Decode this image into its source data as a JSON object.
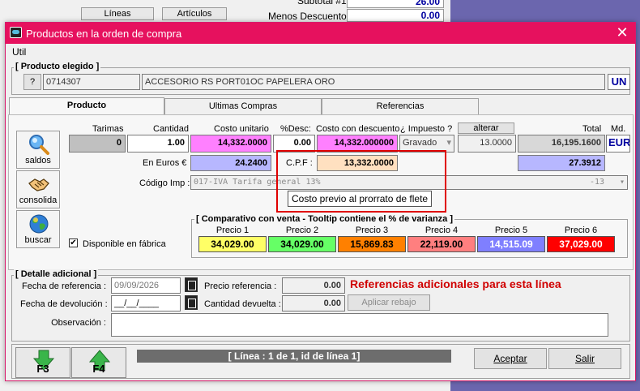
{
  "background": {
    "btn_lineas": "Líneas",
    "btn_articulos": "Artículos",
    "subtotal_label": "Subtotal #1 :",
    "subtotal_value": "26.00",
    "menos_descuento_label": "Menos Descuento :",
    "menos_descuento_value": "0.00"
  },
  "window": {
    "title": "Productos en la orden de compra",
    "menu_util": "Util"
  },
  "producto_elegido": {
    "group_label": "[ Producto elegido ]",
    "help_btn": "?",
    "code": "0714307",
    "description": "ACCESORIO RS PORT01OC PAPELERA ORO",
    "unit": "UN"
  },
  "tabs": [
    "Producto",
    "Ultimas Compras",
    "Referencias"
  ],
  "side_buttons": {
    "saldos": "saldos",
    "consolida": "consolida",
    "buscar": "buscar"
  },
  "grid": {
    "headers": {
      "tarimas": "Tarimas",
      "cantidad": "Cantidad",
      "costo_unitario": "Costo unitario",
      "desc": "%Desc:",
      "costo_con_desc": "Costo con descuento",
      "impuesto": "¿ Impuesto ?",
      "alterar": "alterar",
      "total": "Total",
      "md": "Md."
    },
    "tarimas": "0",
    "cantidad": "1.00",
    "costo_unitario": "14,332.0000",
    "desc": "0.00",
    "costo_con_desc": "14,332.000000",
    "impuesto": "Gravado",
    "alterar_value": "13.0000",
    "total": "16,195.1600",
    "md": "EUR",
    "euros_label": "En Euros €",
    "euros_value": "24.2400",
    "cpf_label": "C.P.F :",
    "cpf_value": "13,332.0000",
    "euros_total": "27.3912",
    "codigo_imp_label": "Código Imp :",
    "codigo_imp_value": "017-IVA Tarifa general 13%",
    "codigo_imp_suffix": "-13",
    "tooltip": "Costo previo al prorrato de flete",
    "disponible": "Disponible en fábrica"
  },
  "comparativo": {
    "label": "[ Comparativo con venta - Tooltip contiene el % de varianza ]",
    "prices": [
      {
        "name": "Precio 1",
        "value": "34,029.00",
        "color": "#ffff66",
        "text": "#000000"
      },
      {
        "name": "Precio 2",
        "value": "34,029.00",
        "color": "#66ff66",
        "text": "#000000"
      },
      {
        "name": "Precio 3",
        "value": "15,869.83",
        "color": "#ff8000",
        "text": "#000000"
      },
      {
        "name": "Precio 4",
        "value": "22,119.00",
        "color": "#ff7f7f",
        "text": "#000000"
      },
      {
        "name": "Precio 5",
        "value": "14,515.09",
        "color": "#7f7fff",
        "text": "#ffffff"
      },
      {
        "name": "Precio 6",
        "value": "37,029.00",
        "color": "#ff0000",
        "text": "#ffffff"
      }
    ]
  },
  "detalle": {
    "group_label": "[ Detalle adicional ]",
    "fecha_ref_label": "Fecha de referencia :",
    "fecha_ref_value": "09/09/2026",
    "fecha_dev_label": "Fecha de devolución :",
    "fecha_dev_value": "__/__/____",
    "precio_ref_label": "Precio referencia :",
    "precio_ref_value": "0.00",
    "cant_dev_label": "Cantidad devuelta :",
    "cant_dev_value": "0.00",
    "aplicar_rebajo": "Aplicar rebajo",
    "observacion_label": "Observación :",
    "observacion_value": "",
    "referencias_text": "Referencias adicionales para esta línea"
  },
  "footer": {
    "f3": "F3",
    "f4": "F4",
    "status": "[ Línea : 1 de 1, id de línea 1]",
    "aceptar": "Aceptar",
    "salir": "Salir"
  },
  "colors": {
    "title_bar": "#e6115e",
    "costo_bg": "#ff80ff",
    "euros_bg": "#b7b7ff",
    "cpf_bg": "#ffe0c0",
    "highlight": "#e00000",
    "referencias_text": "#d00000"
  }
}
